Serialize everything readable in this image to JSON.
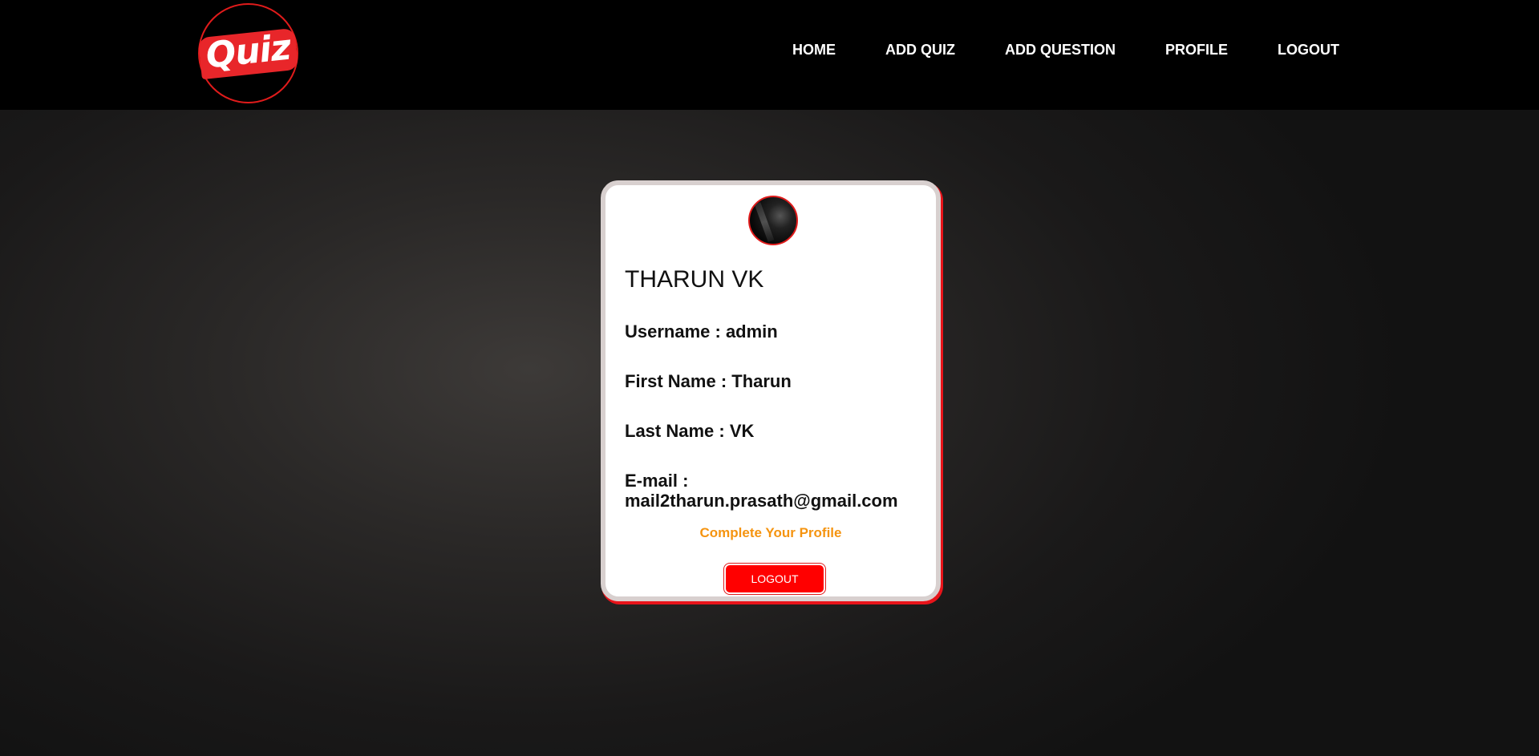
{
  "nav": {
    "logo_text": "Quiz",
    "links": [
      "HOME",
      "ADD QUIZ",
      "ADD QUESTION",
      "PROFILE",
      "LOGOUT"
    ]
  },
  "profile": {
    "full_name": "THARUN VK",
    "username": "Username : admin",
    "first_name": "First Name : Tharun",
    "last_name": "Last Name : VK",
    "email": "E-mail : mail2tharun.prasath@gmail.com",
    "complete_link": "Complete Your Profile",
    "logout_button": "LOGOUT"
  },
  "colors": {
    "accent": "#ff0000",
    "link_orange": "#f59410",
    "navbar": "#000000"
  }
}
